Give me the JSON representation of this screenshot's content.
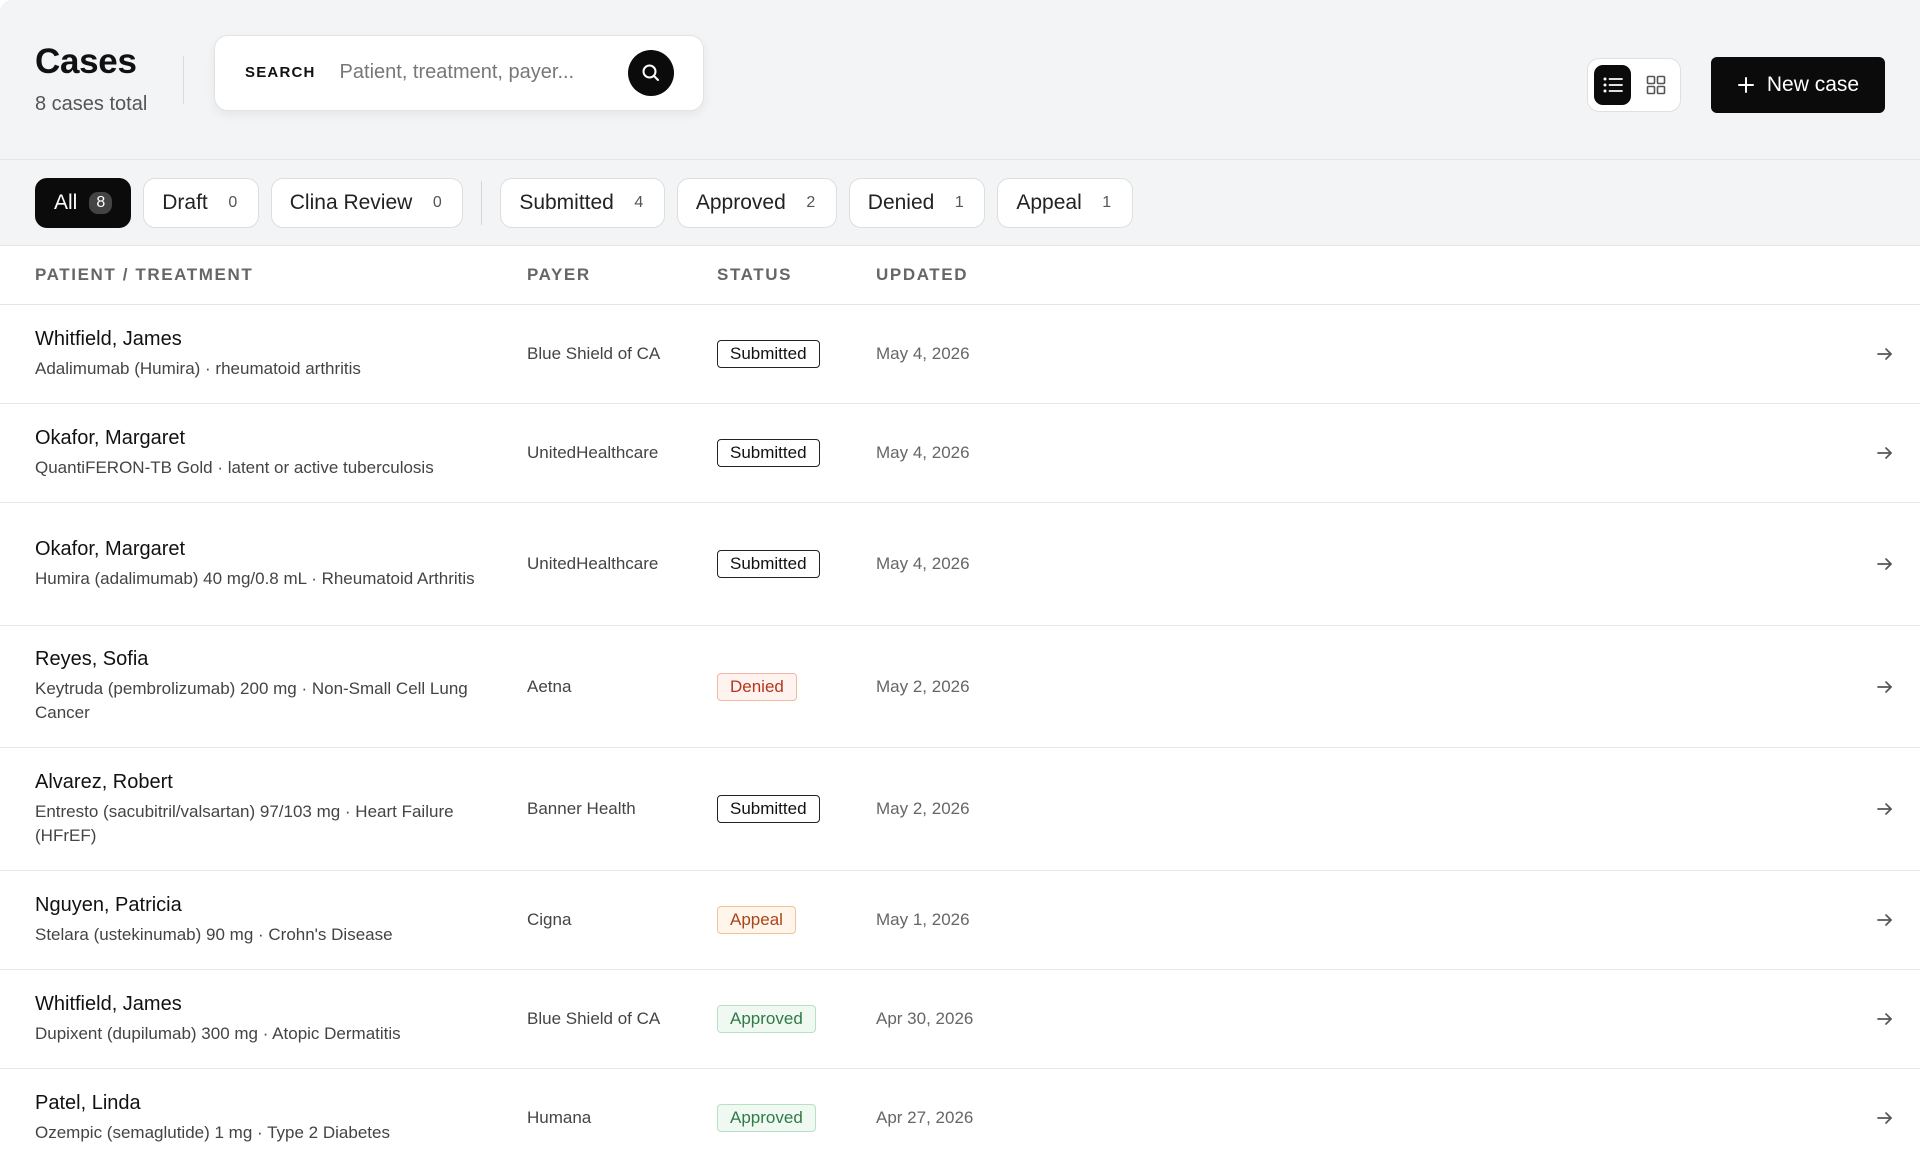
{
  "header": {
    "title": "Cases",
    "subtitle": "8 cases total",
    "search_label": "SEARCH",
    "search_placeholder": "Patient, treatment, payer...",
    "new_case_label": "New case"
  },
  "filters": [
    {
      "label": "All",
      "count": "8",
      "active": true
    },
    {
      "label": "Draft",
      "count": "0"
    },
    {
      "label": "Clina Review",
      "count": "0"
    },
    {
      "label": "Submitted",
      "count": "4"
    },
    {
      "label": "Approved",
      "count": "2"
    },
    {
      "label": "Denied",
      "count": "1"
    },
    {
      "label": "Appeal",
      "count": "1"
    }
  ],
  "table": {
    "columns": [
      "PATIENT / TREATMENT",
      "PAYER",
      "STATUS",
      "UPDATED"
    ],
    "rows": [
      {
        "name": "Whitfield, James",
        "treatment": "Adalimumab (Humira) · rheumatoid arthritis",
        "payer": "Blue Shield of CA",
        "status": "Submitted",
        "updated": "May 4, 2026"
      },
      {
        "name": "Okafor, Margaret",
        "treatment": "QuantiFERON-TB Gold · latent or active tuberculosis",
        "payer": "UnitedHealthcare",
        "status": "Submitted",
        "updated": "May 4, 2026"
      },
      {
        "name": "Okafor, Margaret",
        "treatment": "Humira (adalimumab) 40 mg/0.8 mL · Rheumatoid Arthritis",
        "payer": "UnitedHealthcare",
        "status": "Submitted",
        "updated": "May 4, 2026"
      },
      {
        "name": "Reyes, Sofia",
        "treatment": "Keytruda (pembrolizumab) 200 mg · Non-Small Cell Lung Cancer",
        "payer": "Aetna",
        "status": "Denied",
        "updated": "May 2, 2026"
      },
      {
        "name": "Alvarez, Robert",
        "treatment": "Entresto (sacubitril/valsartan) 97/103 mg · Heart Failure (HFrEF)",
        "payer": "Banner Health",
        "status": "Submitted",
        "updated": "May 2, 2026"
      },
      {
        "name": "Nguyen, Patricia",
        "treatment": "Stelara (ustekinumab) 90 mg · Crohn's Disease",
        "payer": "Cigna",
        "status": "Appeal",
        "updated": "May 1, 2026"
      },
      {
        "name": "Whitfield, James",
        "treatment": "Dupixent (dupilumab) 300 mg · Atopic Dermatitis",
        "payer": "Blue Shield of CA",
        "status": "Approved",
        "updated": "Apr 30, 2026"
      },
      {
        "name": "Patel, Linda",
        "treatment": "Ozempic (semaglutide) 1 mg · Type 2 Diabetes",
        "payer": "Humana",
        "status": "Approved",
        "updated": "Apr 27, 2026"
      }
    ]
  },
  "colors": {
    "accent": "#0b0b0b",
    "denied": "#b3361c",
    "appeal": "#a8451a",
    "approved": "#2f7a45"
  },
  "icons": {
    "search": "search-icon",
    "list_view": "list-view-icon",
    "grid_view": "grid-view-icon",
    "plus": "plus-icon",
    "row_arrow": "arrow-right-icon"
  }
}
